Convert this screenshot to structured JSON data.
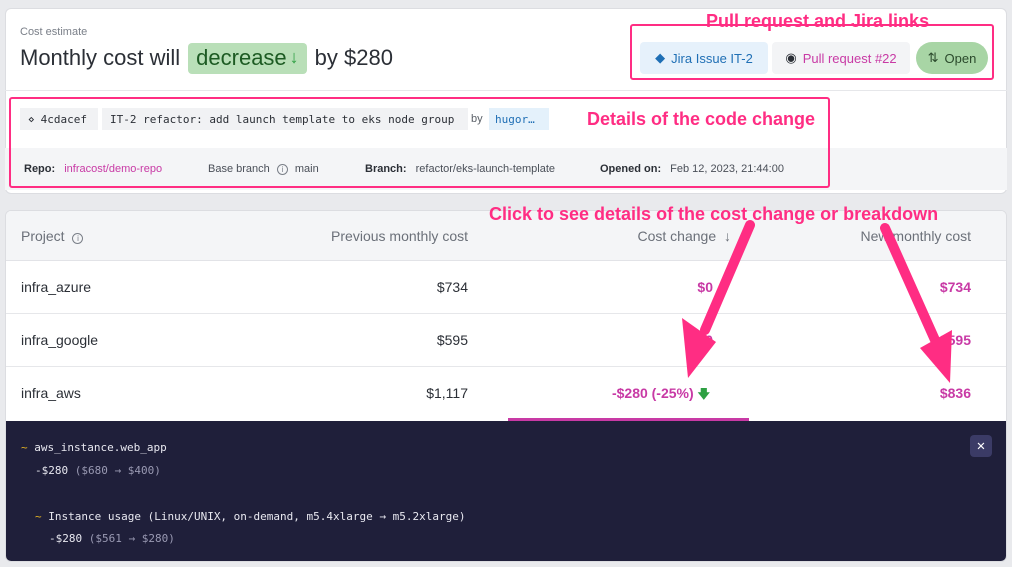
{
  "summary": {
    "label": "Cost estimate",
    "headline_pre": "Monthly cost will",
    "headline_pill": "decrease",
    "headline_post": "by $280",
    "jira_label": "Jira Issue IT-2",
    "pr_label": "Pull request #22",
    "status": "Open"
  },
  "commit": {
    "sha": "4cdacef",
    "message": "IT-2 refactor: add launch template to eks node group",
    "by": "by",
    "author": "hugor…"
  },
  "meta": {
    "repo_label": "Repo:",
    "repo": "infracost/demo-repo",
    "base_label": "Base branch",
    "base": "main",
    "branch_label": "Branch:",
    "branch": "refactor/eks-launch-template",
    "opened_label": "Opened on:",
    "opened": "Feb 12, 2023, 21:44:00"
  },
  "annotations": {
    "links": "Pull request and Jira links",
    "details": "Details of the code change",
    "click": "Click to see details of the cost change or breakdown"
  },
  "table": {
    "headers": {
      "project": "Project",
      "previous": "Previous monthly cost",
      "change": "Cost change",
      "new": "New monthly cost"
    },
    "rows": [
      {
        "project": "infra_azure",
        "previous": "$734",
        "change": "$0",
        "new": "$734"
      },
      {
        "project": "infra_google",
        "previous": "$595",
        "change": "$0",
        "new": "$595"
      },
      {
        "project": "infra_aws",
        "previous": "$1,117",
        "change": "-$280 (-25%)",
        "new": "$836"
      }
    ]
  },
  "breakdown": {
    "l1": "aws_instance.web_app",
    "l2_a": "-$280",
    "l2_b": "($680 → $400)",
    "l3": "Instance usage (Linux/UNIX, on-demand, m5.4xlarge → m5.2xlarge)",
    "l4_a": "-$280",
    "l4_b": "($561 → $280)"
  },
  "colors": {
    "accent_pink": "#c83aa5",
    "annotation": "#ff2d83",
    "decrease_green": "#2ea043",
    "dark_panel": "#1f1f3a"
  }
}
